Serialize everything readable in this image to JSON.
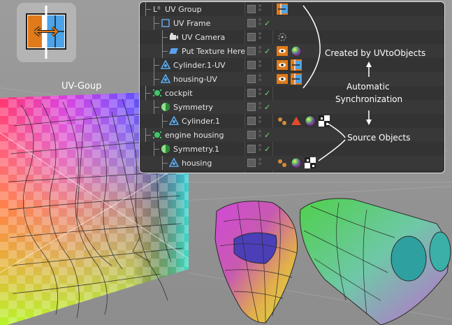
{
  "viewport": {
    "uv_group_label": "UV-Goup"
  },
  "object_manager": {
    "rows": [
      {
        "name": "UV Group",
        "icon": "null-object-icon",
        "check": false,
        "tags": [
          "uv-sync-tag-icon"
        ]
      },
      {
        "name": "UV Frame",
        "icon": "frame-icon",
        "check": true,
        "tags": []
      },
      {
        "name": "UV Camera",
        "icon": "camera-icon",
        "check": false,
        "tags": [
          "camera-target-tag-icon"
        ]
      },
      {
        "name": "Put Texture Here",
        "icon": "plane-icon",
        "check": true,
        "tags": [
          "view-tag-icon",
          "material-sphere-icon"
        ]
      },
      {
        "name": "Cylinder.1-UV",
        "icon": "polygon-object-icon",
        "check": false,
        "tags": [
          "view-tag-icon",
          "uv-sync-tag-icon"
        ]
      },
      {
        "name": "housing-UV",
        "icon": "polygon-object-icon",
        "check": false,
        "tags": [
          "view-tag-icon",
          "uv-sync-tag-icon"
        ]
      },
      {
        "name": "cockpit",
        "icon": "group-object-icon",
        "check": true,
        "tags": []
      },
      {
        "name": "Symmetry",
        "icon": "symmetry-icon",
        "check": true,
        "tags": []
      },
      {
        "name": "Cylinder.1",
        "icon": "polygon-object-icon",
        "check": false,
        "tags": [
          "phong-tag-icon",
          "polygon-selection-tag-icon",
          "material-sphere-icon",
          "uvw-tag-icon"
        ]
      },
      {
        "name": "engine housing",
        "icon": "group-object-icon",
        "check": true,
        "tags": []
      },
      {
        "name": "Symmetry.1",
        "icon": "symmetry-icon",
        "check": true,
        "tags": []
      },
      {
        "name": "housing",
        "icon": "polygon-object-icon",
        "check": false,
        "tags": [
          "phong-tag-icon",
          "material-sphere-icon",
          "uvw-tag-icon"
        ]
      }
    ]
  },
  "annotations": {
    "created_by": "Created by UVtoObjects",
    "automatic": "Automatic",
    "synchronization": "Synchronization",
    "source_objects": "Source Objects"
  },
  "colors": {
    "panel_bg": "#333333",
    "check_green": "#6be26b",
    "accent_orange": "#e07a1a",
    "accent_blue": "#3d8fd9"
  }
}
